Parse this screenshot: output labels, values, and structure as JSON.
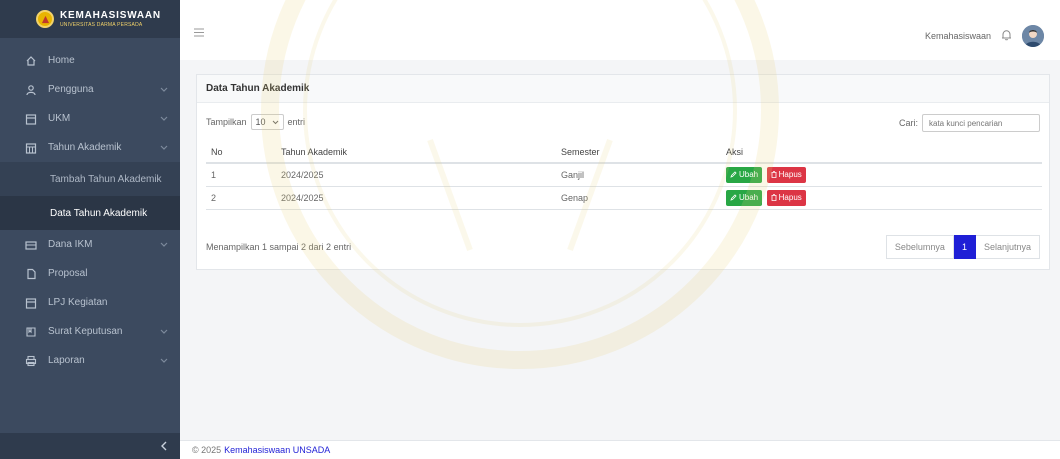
{
  "brand": {
    "name": "KEMAHASISWAAN",
    "subtitle": "UNIVERSITAS DARMA PERSADA"
  },
  "sidebar": {
    "items": [
      {
        "label": "Home",
        "icon": "home-icon"
      },
      {
        "label": "Pengguna",
        "icon": "user-icon",
        "has_children": true
      },
      {
        "label": "UKM",
        "icon": "calendar-icon",
        "has_children": true
      },
      {
        "label": "Tahun Akademik",
        "icon": "calendar-grid-icon",
        "has_children": true,
        "open": true
      },
      {
        "label": "Dana IKM",
        "icon": "money-icon",
        "has_children": true
      },
      {
        "label": "Proposal",
        "icon": "file-icon"
      },
      {
        "label": "LPJ Kegiatan",
        "icon": "calendar-icon"
      },
      {
        "label": "Surat Keputusan",
        "icon": "doc-icon",
        "has_children": true
      },
      {
        "label": "Laporan",
        "icon": "print-icon",
        "has_children": true
      }
    ],
    "sub_items": [
      {
        "label": "Tambah Tahun Akademik",
        "active": false
      },
      {
        "label": "Data Tahun Akademik",
        "active": true
      }
    ]
  },
  "topbar": {
    "user_name": "Kemahasiswaan"
  },
  "card": {
    "title": "Data Tahun Akademik"
  },
  "table_controls": {
    "show_label": "Tampilkan",
    "show_value": "10",
    "entries_label": "entri",
    "search_label": "Cari:",
    "search_placeholder": "kata kunci pencarian"
  },
  "table": {
    "headers": [
      "No",
      "Tahun Akademik",
      "Semester",
      "Aksi"
    ],
    "rows": [
      {
        "no": "1",
        "tahun": "2024/2025",
        "semester": "Ganjil"
      },
      {
        "no": "2",
        "tahun": "2024/2025",
        "semester": "Genap"
      }
    ],
    "edit_label": "Ubah",
    "delete_label": "Hapus"
  },
  "info_text": "Menampilkan 1 sampai 2 dari 2 entri",
  "pagination": {
    "prev": "Sebelumnya",
    "current": "1",
    "next": "Selanjutnya"
  },
  "footer": {
    "copyright": "© 2025",
    "link_text": "Kemahasiswaan UNSADA"
  },
  "colors": {
    "sidebar": "#3c4a5f",
    "primary": "#1f1fd6",
    "success": "#28a745",
    "danger": "#dc3545"
  }
}
